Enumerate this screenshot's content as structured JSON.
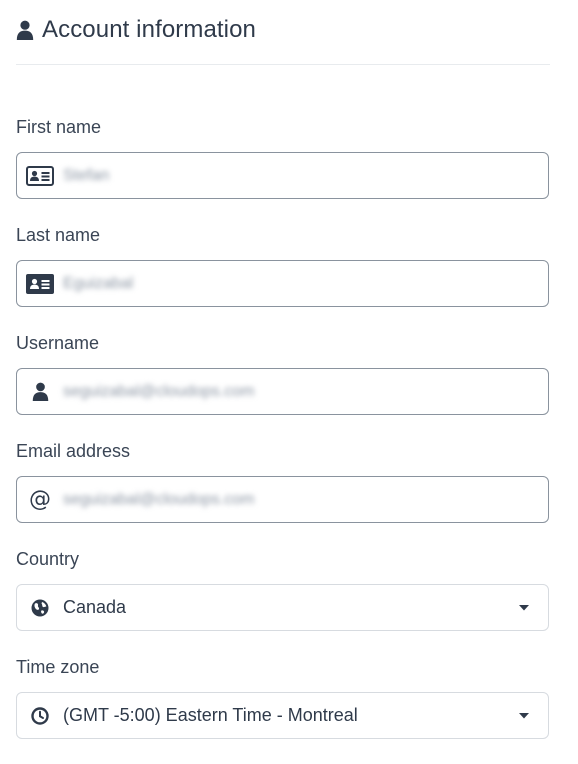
{
  "header": {
    "title": "Account information",
    "icon": "user-icon"
  },
  "fields": {
    "first_name": {
      "label": "First name",
      "value": "Stefan",
      "icon": "id-card-icon"
    },
    "last_name": {
      "label": "Last name",
      "value": "Eguizabal",
      "icon": "id-card-icon"
    },
    "username": {
      "label": "Username",
      "value": "seguizabal@cloudops.com",
      "icon": "user-icon"
    },
    "email": {
      "label": "Email address",
      "value": "seguizabal@cloudops.com",
      "icon": "at-icon"
    },
    "country": {
      "label": "Country",
      "value": "Canada",
      "icon": "globe-icon"
    },
    "timezone": {
      "label": "Time zone",
      "value": "(GMT -5:00) Eastern Time - Montreal",
      "icon": "clock-icon"
    }
  },
  "colors": {
    "text": "#2f3a4a",
    "border_active": "#8a939e",
    "border_select": "#d7dbe0",
    "divider": "#e8ebee"
  }
}
